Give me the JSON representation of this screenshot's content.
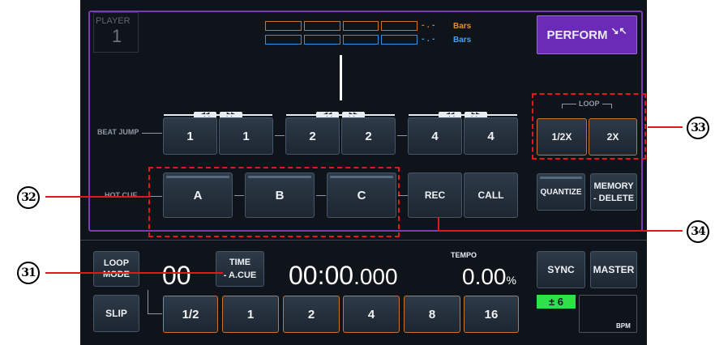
{
  "player": {
    "label": "PLAYER",
    "number": "1"
  },
  "bars": {
    "orange_suffix": "Bars",
    "blue_suffix": "Bars",
    "orange_dots": "- . -",
    "blue_dots": "- . -"
  },
  "perform": {
    "label": "PERFORM",
    "icon": "collapse-arrows-icon"
  },
  "beat_jump": {
    "label": "BEAT JUMP",
    "buttons": [
      "1",
      "1",
      "2",
      "2",
      "4",
      "4"
    ]
  },
  "hot_cue": {
    "label": "HOT CUE",
    "buttons": [
      "A",
      "B",
      "C"
    ],
    "rec": "REC",
    "call": "CALL"
  },
  "loop": {
    "label": "LOOP",
    "half": "1/2X",
    "double": "2X"
  },
  "quantize": "QUANTIZE",
  "memory_delete": {
    "line1": "MEMORY",
    "line2": "- DELETE"
  },
  "bottom": {
    "loop_mode": {
      "line1": "LOOP",
      "line2": "MODE"
    },
    "slip": "SLIP",
    "loop_count": "00",
    "time": {
      "line1": "TIME",
      "line2": "- A.CUE"
    },
    "time_display": {
      "main": "00:00",
      "ms": ".000"
    },
    "tempo_label": "TEMPO",
    "tempo_value": "0.00",
    "tempo_unit": "%",
    "beat_buttons": [
      "1/2",
      "1",
      "2",
      "4",
      "8",
      "16"
    ],
    "sync": "SYNC",
    "master": "MASTER",
    "tempo_range": "± 6",
    "bpm_label": "BPM"
  },
  "callouts": {
    "c31": "31",
    "c32": "32",
    "c33": "33",
    "c34": "34"
  },
  "colors": {
    "accent_purple": "#6b2bb6",
    "orange": "#c9732b",
    "blue": "#3a8fd8",
    "green": "#2ee04a",
    "callout_red": "#e0191e"
  }
}
